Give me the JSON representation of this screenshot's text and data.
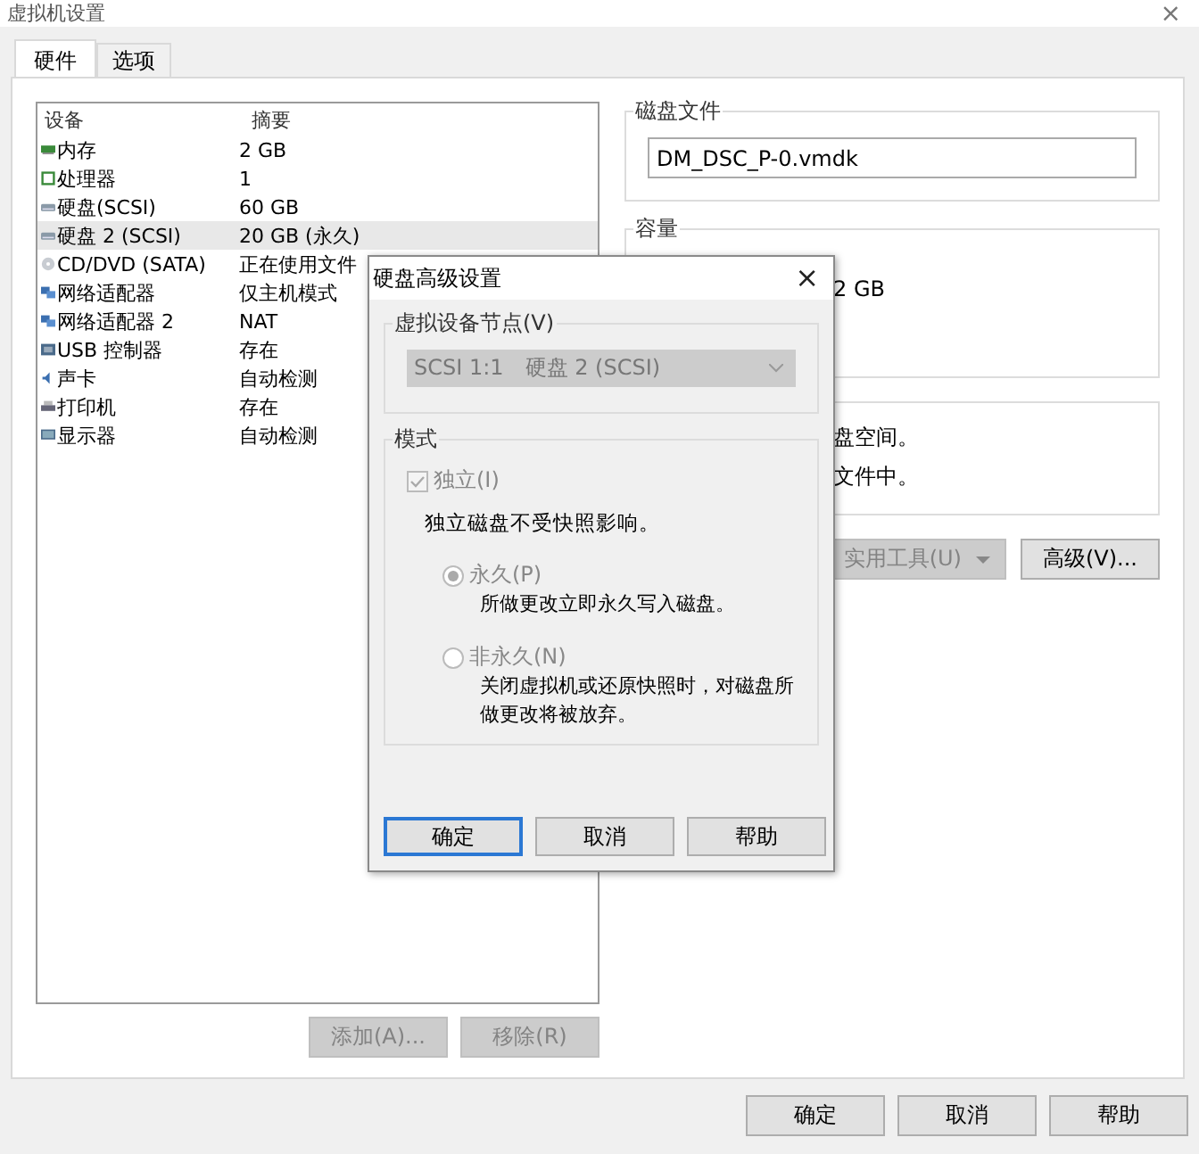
{
  "window": {
    "title": "虚拟机设置",
    "close": "×"
  },
  "tabs": [
    {
      "label": "硬件",
      "selected": true
    },
    {
      "label": "选项",
      "selected": false
    }
  ],
  "devices": {
    "columns": [
      "设备",
      "摘要"
    ],
    "rows": [
      {
        "kind": "memory",
        "name": "内存",
        "summary": "2 GB",
        "selected": false
      },
      {
        "kind": "cpu",
        "name": "处理器",
        "summary": "1",
        "selected": false
      },
      {
        "kind": "disk",
        "name": "硬盘(SCSI)",
        "summary": "60 GB",
        "selected": false
      },
      {
        "kind": "disk",
        "name": "硬盘 2 (SCSI)",
        "summary": "20 GB (永久)",
        "selected": true
      },
      {
        "kind": "cdrom",
        "name": "CD/DVD (SATA)",
        "summary": "正在使用文件",
        "selected": false
      },
      {
        "kind": "network",
        "name": "网络适配器",
        "summary": "仅主机模式",
        "selected": false
      },
      {
        "kind": "network",
        "name": "网络适配器 2",
        "summary": "NAT",
        "selected": false
      },
      {
        "kind": "usb",
        "name": "USB 控制器",
        "summary": "存在",
        "selected": false
      },
      {
        "kind": "sound",
        "name": "声卡",
        "summary": "自动检测",
        "selected": false
      },
      {
        "kind": "printer",
        "name": "打印机",
        "summary": "存在",
        "selected": false
      },
      {
        "kind": "display",
        "name": "显示器",
        "summary": "自动检测",
        "selected": false
      }
    ]
  },
  "device_buttons": [
    {
      "label": "添加(A)...",
      "disabled": true
    },
    {
      "label": "移除(R)",
      "disabled": true
    }
  ],
  "disk_file": {
    "title": "磁盘文件",
    "value": "DM_DSC_P-0.vmdk"
  },
  "capacity": {
    "title": "容量",
    "lines": [
      "2 GB"
    ]
  },
  "info": {
    "lines": [
      "盘空间。",
      "文件中。"
    ]
  },
  "disk_buttons": [
    {
      "label": "实用工具(U)",
      "disabled": true,
      "dropdown": true
    },
    {
      "label": "高级(V)...",
      "disabled": false,
      "dropdown": false
    }
  ],
  "dialog": {
    "title": "硬盘高级设置",
    "close": "×",
    "node": {
      "title": "虚拟设备节点(V)",
      "value": "SCSI 1:1　硬盘 2 (SCSI)",
      "disabled": true
    },
    "mode": {
      "title": "模式",
      "independent": {
        "label": "独立(I)",
        "checked": true,
        "disabled": true
      },
      "note": "独立磁盘不受快照影响。",
      "options": [
        {
          "label": "永久(P)",
          "desc": "所做更改立即永久写入磁盘。",
          "selected": true,
          "disabled": true
        },
        {
          "label": "非永久(N)",
          "desc": "关闭虚拟机或还原快照时，对磁盘所做更改将被放弃。",
          "selected": false,
          "disabled": true
        }
      ]
    },
    "buttons": [
      {
        "label": "确定",
        "focused": true
      },
      {
        "label": "取消",
        "focused": false
      },
      {
        "label": "帮助",
        "focused": false
      }
    ]
  },
  "buttons": [
    "确定",
    "取消",
    "帮助"
  ]
}
